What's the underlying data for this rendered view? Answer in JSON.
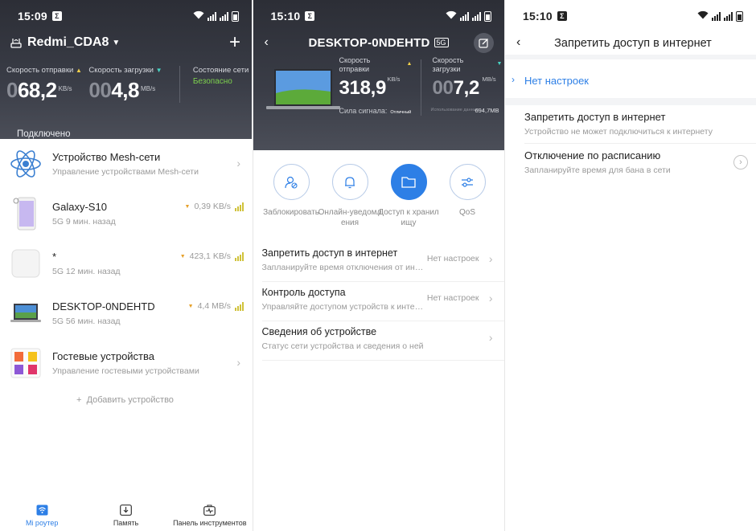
{
  "colors": {
    "accent": "#2d7fe6",
    "ok_green": "#7dd04e",
    "upload_arrow": "#f2d14a",
    "download_arrow": "#47d3c3"
  },
  "screen1": {
    "status_time": "15:09",
    "router_name": "Redmi_CDA8",
    "upload_label": "Скорость отправки",
    "upload_dim": "0",
    "upload_value": "68,2",
    "upload_unit": "KB/s",
    "download_label": "Скорость загрузки",
    "download_dim": "00",
    "download_value": "4,8",
    "download_unit": "MB/s",
    "net_state_label": "Состояние сети",
    "net_state_value": "Безопасно",
    "connected_label": "Подключено",
    "devices": [
      {
        "title": "Устройство Mesh-сети",
        "sub": "Управление устройствами Mesh-сети",
        "icon": "mesh-atom-icon"
      },
      {
        "title": "Galaxy-S10",
        "sub": "5G   9 мин. назад",
        "speed": "0,39 KB/s",
        "icon": "phone-icon"
      },
      {
        "title": "*",
        "sub": "5G   12 мин. назад",
        "speed": "423,1 KB/s",
        "icon": "device-box-icon"
      },
      {
        "title": "DESKTOP-0NDEHTD",
        "sub": "5G   56 мин. назад",
        "speed": "4,4 MB/s",
        "icon": "laptop-icon"
      },
      {
        "title": "Гостевые устройства",
        "sub": "Управление гостевыми устройствами",
        "icon": "guest-devices-icon"
      }
    ],
    "add_device": "Добавить устройство",
    "tabs": [
      {
        "label": "Mi роутер",
        "icon": "wifi-router-icon",
        "active": true
      },
      {
        "label": "Память",
        "icon": "storage-icon",
        "active": false
      },
      {
        "label": "Панель инструментов",
        "icon": "toolbox-icon",
        "active": false
      }
    ]
  },
  "screen2": {
    "status_time": "15:10",
    "device_name": "DESKTOP-0NDEHTD",
    "band": "5G",
    "upload_label": "Скорость отправки",
    "upload_value": "318,9",
    "upload_unit": "KB/s",
    "download_label": "Скорость загрузки",
    "download_dim": "00",
    "download_value": "7,2",
    "download_unit": "MB/s",
    "signal_label": "Сила сигнала:",
    "signal_value": "Отличный",
    "data_usage_label": "Использование данных",
    "data_usage_value": "694,7MB",
    "actions": [
      {
        "label": "Заблокировать",
        "icon": "block-user-icon",
        "active": false
      },
      {
        "label": "Онлайн-уведомления",
        "icon": "bell-icon",
        "active": false
      },
      {
        "label": "Доступ к хранилищу",
        "icon": "folder-icon",
        "active": true
      },
      {
        "label": "QoS",
        "icon": "sliders-icon",
        "active": false
      }
    ],
    "menu": [
      {
        "title": "Запретить доступ в интернет",
        "sub": "Запланируйте время отключения от интернета",
        "value": "Нет настроек"
      },
      {
        "title": "Контроль доступа",
        "sub": "Управляйте доступом устройств к интернету",
        "value": "Нет настроек"
      },
      {
        "title": "Сведения об устройстве",
        "sub": "Статус сети устройства и сведения о ней",
        "value": ""
      }
    ]
  },
  "screen3": {
    "status_time": "15:10",
    "title": "Запретить доступ в интернет",
    "selected_option": "Нет настроек",
    "options": [
      {
        "title": "Запретить доступ в интернет",
        "sub": "Устройство не может подключиться к интернету"
      },
      {
        "title": "Отключение по расписанию",
        "sub": "Запланируйте время для бана в сети"
      }
    ]
  }
}
